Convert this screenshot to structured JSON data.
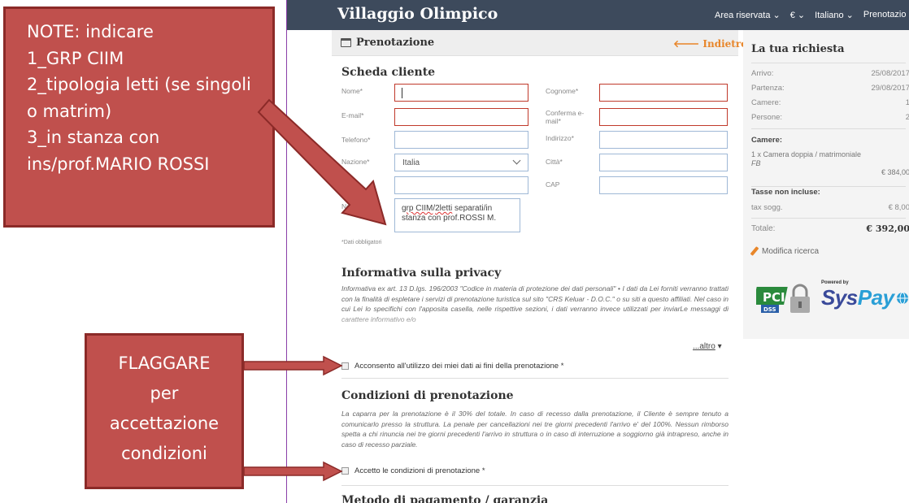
{
  "navbar": {
    "brand": "Villaggio Olimpico",
    "links": [
      "Area riservata ⌄",
      "€ ⌄",
      "Italiano ⌄",
      "Prenotazio"
    ]
  },
  "panel": {
    "title": "Prenotazione",
    "back": "🡐 Indietro"
  },
  "form": {
    "heading": "Scheda cliente",
    "labels": {
      "nome": "Nome*",
      "cognome": "Cognome*",
      "email": "E-mail*",
      "conferma_email": "Conferma e-mail*",
      "telefono": "Telefono*",
      "indirizzo": "Indirizzo*",
      "nazione": "Nazione*",
      "citta": "Città*",
      "provincia": "Prov",
      "cap": "CAP",
      "note": "Note"
    },
    "nazione_value": "Italia",
    "note_value_a": "grp CIIM",
    "note_value_b": "/",
    "note_value_c": "2letti",
    "note_value_d": " separati/in stanza con prof.ROSSI M.",
    "required_note": "*Dati obbligatori"
  },
  "privacy": {
    "heading": "Informativa sulla privacy",
    "text": "Informativa ex art. 13 D.lgs. 196/2003 \"Codice in materia di protezione dei dati personali\" • I dati da Lei forniti verranno trattati con la finalità di espletare i servizi di prenotazione turistica sul sito \"CRS Keluar - D.O.C.\" o su siti a questo affiliati. Nel caso in cui Lei lo specifichi con l'apposita casella, nelle rispettive sezioni, i dati verranno invece utilizzati per inviarLe messaggi di carattere informativo e/o",
    "more": "...altro",
    "consent": "Acconsento all'utilizzo dei miei dati ai fini della prenotazione *"
  },
  "conditions": {
    "heading": "Condizioni di prenotazione",
    "text": "La caparra per la prenotazione è il 30% del totale. In caso di recesso dalla prenotazione, il Cliente è sempre tenuto a comunicarlo presso la struttura. La penale per cancellazioni nei tre giorni precedenti l'arrivo e' del 100%. Nessun rimborso spetta a chi rinuncia nei tre giorni precedenti l'arrivo in struttura o in caso di interruzione a soggiorno già intrapreso, anche in caso di recesso parziale.",
    "accept": "Accetto le condizioni di prenotazione *",
    "next_heading": "Metodo di pagamento / garanzia"
  },
  "sidebar": {
    "title": "La tua richiesta",
    "rows": [
      {
        "label": "Arrivo:",
        "value": "25/08/2017"
      },
      {
        "label": "Partenza:",
        "value": "29/08/2017"
      },
      {
        "label": "Camere:",
        "value": "1"
      },
      {
        "label": "Persone:",
        "value": "2"
      }
    ],
    "camere_heading": "Camere:",
    "camera_item": "1 x Camera doppia / matrimoniale",
    "camera_board": "FB",
    "camera_price": "€ 384,00",
    "tasse_heading": "Tasse non incluse:",
    "tasse_label": "tax sogg.",
    "tasse_value": "€ 8,00",
    "totale_label": "Totale:",
    "totale_value": "€ 392,00",
    "modifica": "Modifica ricerca",
    "powered": "Powered by",
    "syspay_a": "Sys",
    "syspay_b": "Pay"
  },
  "annotations": {
    "note": "NOTE: indicare\n1_GRP CIIM\n2_tipologia letti (se singoli o matrim)\n3_in stanza con ins/prof.MARIO ROSSI",
    "flag": "FLAGGARE\nper\naccettazione\ncondizioni"
  },
  "colors": {
    "navbar": "#3d4a5c",
    "accent": "#e8862a",
    "required_border": "#c0392b",
    "annotation_fill": "#c0504d",
    "annotation_border": "#8b2a28"
  }
}
